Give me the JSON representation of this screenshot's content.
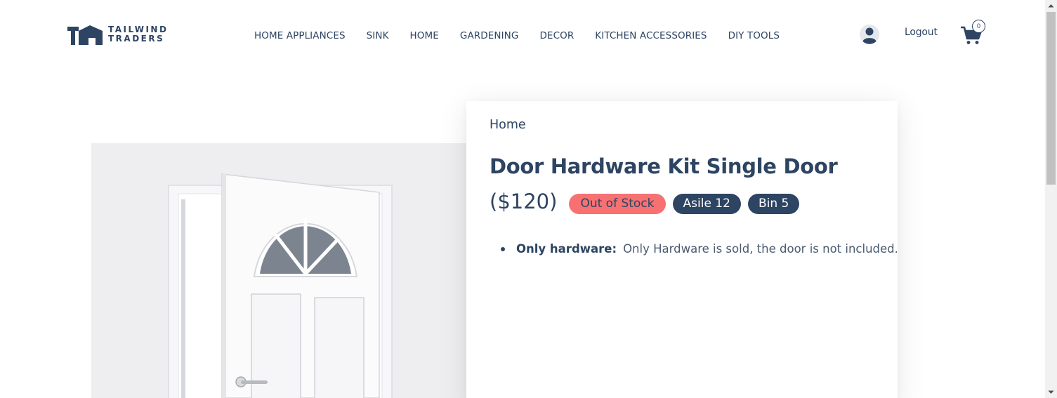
{
  "header": {
    "logo": {
      "line1": "TAILWIND",
      "line2": "TRADERS"
    },
    "nav": [
      "HOME APPLIANCES",
      "SINK",
      "HOME",
      "GARDENING",
      "DECOR",
      "KITCHEN ACCESSORIES",
      "DIY TOOLS"
    ],
    "logout_label": "Logout",
    "cart_count": "0"
  },
  "product": {
    "breadcrumb": "Home",
    "title": "Door Hardware Kit Single Door",
    "price": "($120)",
    "badges": {
      "stock": "Out of Stock",
      "aisle": "Asile 12",
      "bin": "Bin 5"
    },
    "features": [
      {
        "label": "Only hardware:",
        "text": "Only Hardware is sold, the door is not included."
      }
    ]
  },
  "colors": {
    "brand": "#2d4462",
    "out_of_stock": "#f77172",
    "image_bg": "#eeeef0"
  },
  "icons": [
    "user-icon",
    "cart-icon",
    "logo-icon"
  ]
}
